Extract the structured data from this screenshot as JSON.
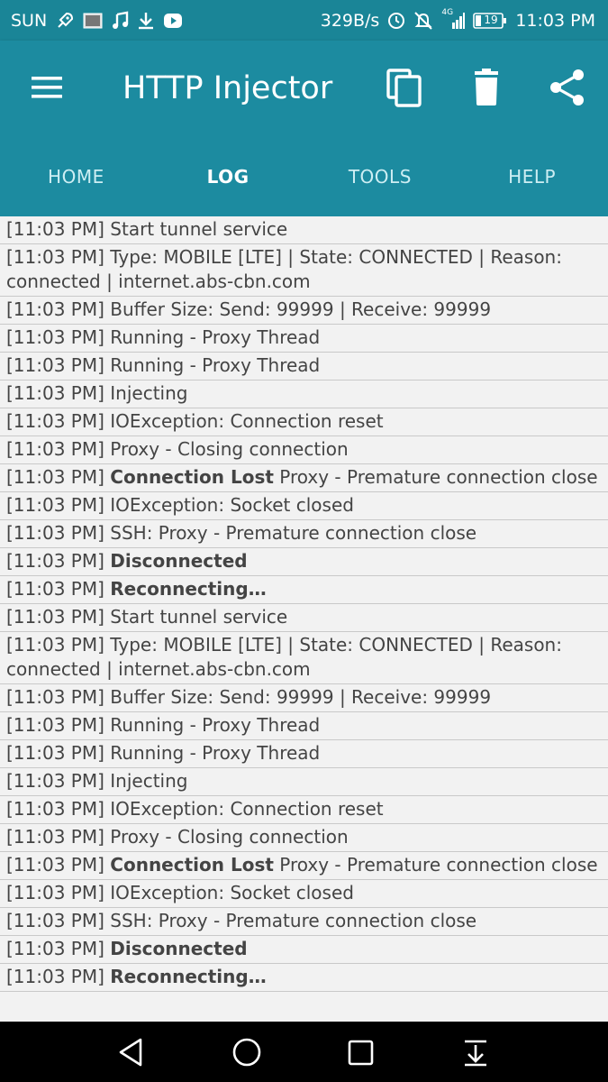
{
  "status_bar": {
    "carrier": "SUN",
    "net_speed": "329B/s",
    "network_type": "4G",
    "battery_level": "19",
    "time": "11:03 PM",
    "icons": [
      "rocket-icon",
      "image-icon",
      "music-icon",
      "download-icon",
      "youtube-icon",
      "sync-icon",
      "mute-icon",
      "signal-icon",
      "battery-icon"
    ]
  },
  "app_bar": {
    "title": "HTTP Injector",
    "actions": [
      "menu-icon",
      "copy-icon",
      "delete-icon",
      "share-icon"
    ],
    "background": "#1c8ba0"
  },
  "tabs": [
    {
      "label": "HOME",
      "active": false
    },
    {
      "label": "LOG",
      "active": true
    },
    {
      "label": "TOOLS",
      "active": false
    },
    {
      "label": "HELP",
      "active": false
    }
  ],
  "log": [
    {
      "ts": "[11:03 PM]",
      "bold": "",
      "text": "Start tunnel service"
    },
    {
      "ts": "[11:03 PM]",
      "bold": "",
      "text": "Type: MOBILE [LTE] | State: CONNECTED | Reason: connected | internet.abs-cbn.com"
    },
    {
      "ts": "[11:03 PM]",
      "bold": "",
      "text": "Buffer Size: Send: 99999 | Receive: 99999"
    },
    {
      "ts": "[11:03 PM]",
      "bold": "",
      "text": "Running - Proxy Thread"
    },
    {
      "ts": "[11:03 PM]",
      "bold": "",
      "text": "Running - Proxy Thread"
    },
    {
      "ts": "[11:03 PM]",
      "bold": "",
      "text": "Injecting"
    },
    {
      "ts": "[11:03 PM]",
      "bold": "",
      "text": "IOException: Connection reset"
    },
    {
      "ts": "[11:03 PM]",
      "bold": "",
      "text": "Proxy - Closing connection"
    },
    {
      "ts": "[11:03 PM]",
      "bold": "Connection Lost",
      "text": "Proxy - Premature connection close"
    },
    {
      "ts": "[11:03 PM]",
      "bold": "",
      "text": "IOException: Socket closed"
    },
    {
      "ts": "[11:03 PM]",
      "bold": "",
      "text": "SSH: Proxy - Premature connection close"
    },
    {
      "ts": "[11:03 PM]",
      "bold": "Disconnected",
      "text": ""
    },
    {
      "ts": "[11:03 PM]",
      "bold": "Reconnecting…",
      "text": ""
    },
    {
      "ts": "[11:03 PM]",
      "bold": "",
      "text": "Start tunnel service"
    },
    {
      "ts": "[11:03 PM]",
      "bold": "",
      "text": "Type: MOBILE [LTE] | State: CONNECTED | Reason: connected | internet.abs-cbn.com"
    },
    {
      "ts": "[11:03 PM]",
      "bold": "",
      "text": "Buffer Size: Send: 99999 | Receive: 99999"
    },
    {
      "ts": "[11:03 PM]",
      "bold": "",
      "text": "Running - Proxy Thread"
    },
    {
      "ts": "[11:03 PM]",
      "bold": "",
      "text": "Running - Proxy Thread"
    },
    {
      "ts": "[11:03 PM]",
      "bold": "",
      "text": "Injecting"
    },
    {
      "ts": "[11:03 PM]",
      "bold": "",
      "text": "IOException: Connection reset"
    },
    {
      "ts": "[11:03 PM]",
      "bold": "",
      "text": "Proxy - Closing connection"
    },
    {
      "ts": "[11:03 PM]",
      "bold": "Connection Lost",
      "text": "Proxy - Premature connection close"
    },
    {
      "ts": "[11:03 PM]",
      "bold": "",
      "text": "IOException: Socket closed"
    },
    {
      "ts": "[11:03 PM]",
      "bold": "",
      "text": "SSH: Proxy - Premature connection close"
    },
    {
      "ts": "[11:03 PM]",
      "bold": "Disconnected",
      "text": ""
    },
    {
      "ts": "[11:03 PM]",
      "bold": "Reconnecting…",
      "text": ""
    }
  ],
  "nav_bar": {
    "buttons": [
      "back-icon",
      "home-icon",
      "recent-apps-icon",
      "notification-pull-icon"
    ]
  }
}
